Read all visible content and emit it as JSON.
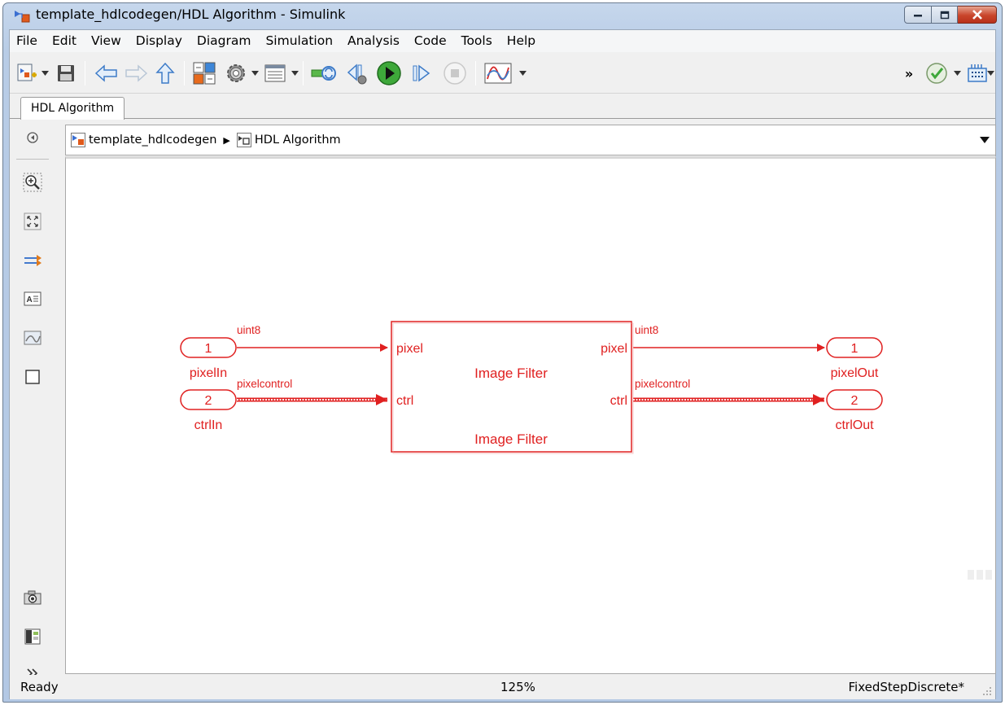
{
  "window": {
    "title": "template_hdlcodegen/HDL Algorithm - Simulink"
  },
  "menubar": {
    "items": [
      "File",
      "Edit",
      "View",
      "Display",
      "Diagram",
      "Simulation",
      "Analysis",
      "Code",
      "Tools",
      "Help"
    ]
  },
  "toolbar": {
    "overflow_label": "»"
  },
  "tabs": [
    {
      "label": "HDL Algorithm",
      "active": true
    }
  ],
  "breadcrumb": [
    {
      "label": "template_hdlcodegen"
    },
    {
      "label": "HDL Algorithm"
    }
  ],
  "diagram": {
    "inports": [
      {
        "number": "1",
        "name": "pixelIn",
        "signal": "uint8"
      },
      {
        "number": "2",
        "name": "ctrlIn",
        "signal": "pixelcontrol"
      }
    ],
    "subsystem": {
      "title": "Image Filter",
      "label": "Image Filter",
      "in_ports": [
        "pixel",
        "ctrl"
      ],
      "out_ports": [
        "pixel",
        "ctrl"
      ]
    },
    "outports": [
      {
        "number": "1",
        "name": "pixelOut",
        "signal": "uint8"
      },
      {
        "number": "2",
        "name": "ctrlOut",
        "signal": "pixelcontrol"
      }
    ],
    "highlight_color": "#e02020"
  },
  "statusbar": {
    "status": "Ready",
    "zoom": "125%",
    "solver": "FixedStepDiscrete*"
  }
}
